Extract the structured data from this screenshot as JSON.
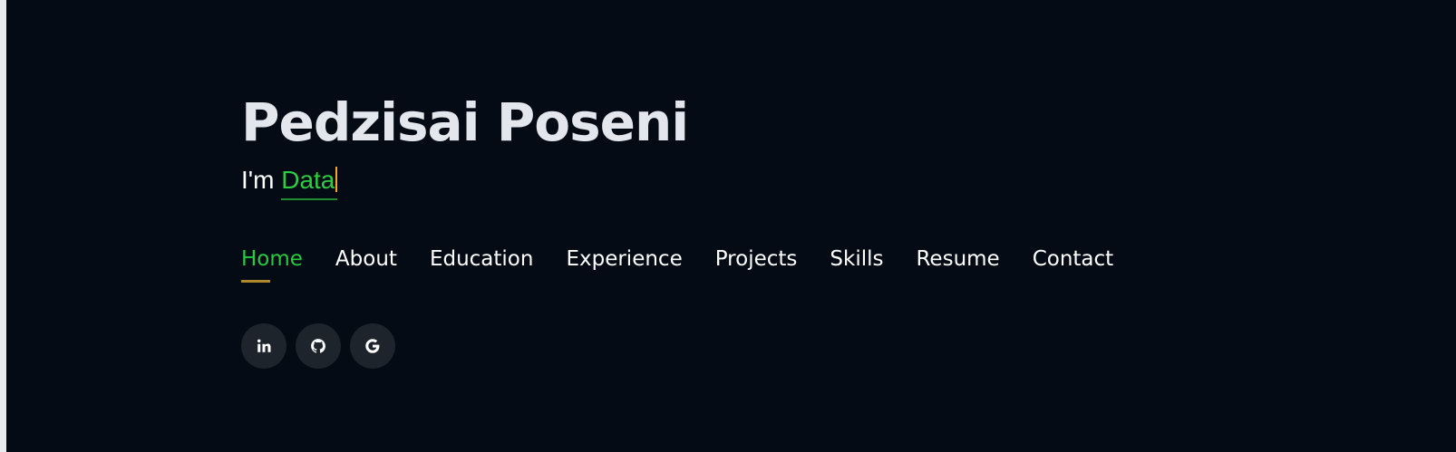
{
  "hero": {
    "name": "Pedzisai Poseni",
    "tagline_prefix": "I'm ",
    "tagline_typed": "Data"
  },
  "nav": {
    "items": [
      {
        "label": "Home",
        "active": true
      },
      {
        "label": "About"
      },
      {
        "label": "Education"
      },
      {
        "label": "Experience"
      },
      {
        "label": "Projects"
      },
      {
        "label": "Skills"
      },
      {
        "label": "Resume"
      },
      {
        "label": "Contact"
      }
    ]
  },
  "social": {
    "links": [
      {
        "icon": "linkedin-icon"
      },
      {
        "icon": "github-icon"
      },
      {
        "icon": "google-icon"
      }
    ]
  },
  "colors": {
    "background": "#040b14",
    "accent_green": "#2ecc40",
    "cursor_orange": "#f5a623",
    "active_underline": "#b08a2a",
    "social_bg": "#1e242c"
  }
}
